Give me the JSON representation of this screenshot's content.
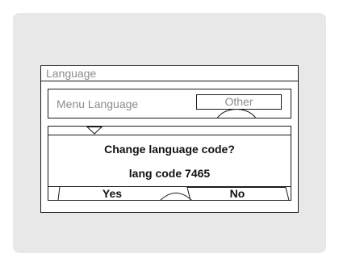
{
  "window": {
    "title": "Language"
  },
  "setting": {
    "label": "Menu Language",
    "value": "Other"
  },
  "dialog": {
    "question": "Change language code?",
    "code_text": "lang code 7465",
    "yes_label": "Yes",
    "no_label": "No"
  },
  "icons": {
    "scroll": "chevron-down-icon"
  },
  "colors": {
    "screen_background": "#e8e8e8",
    "dimmed_text": "#8c8c8c",
    "text": "#111111",
    "border": "#1a1a1a"
  }
}
